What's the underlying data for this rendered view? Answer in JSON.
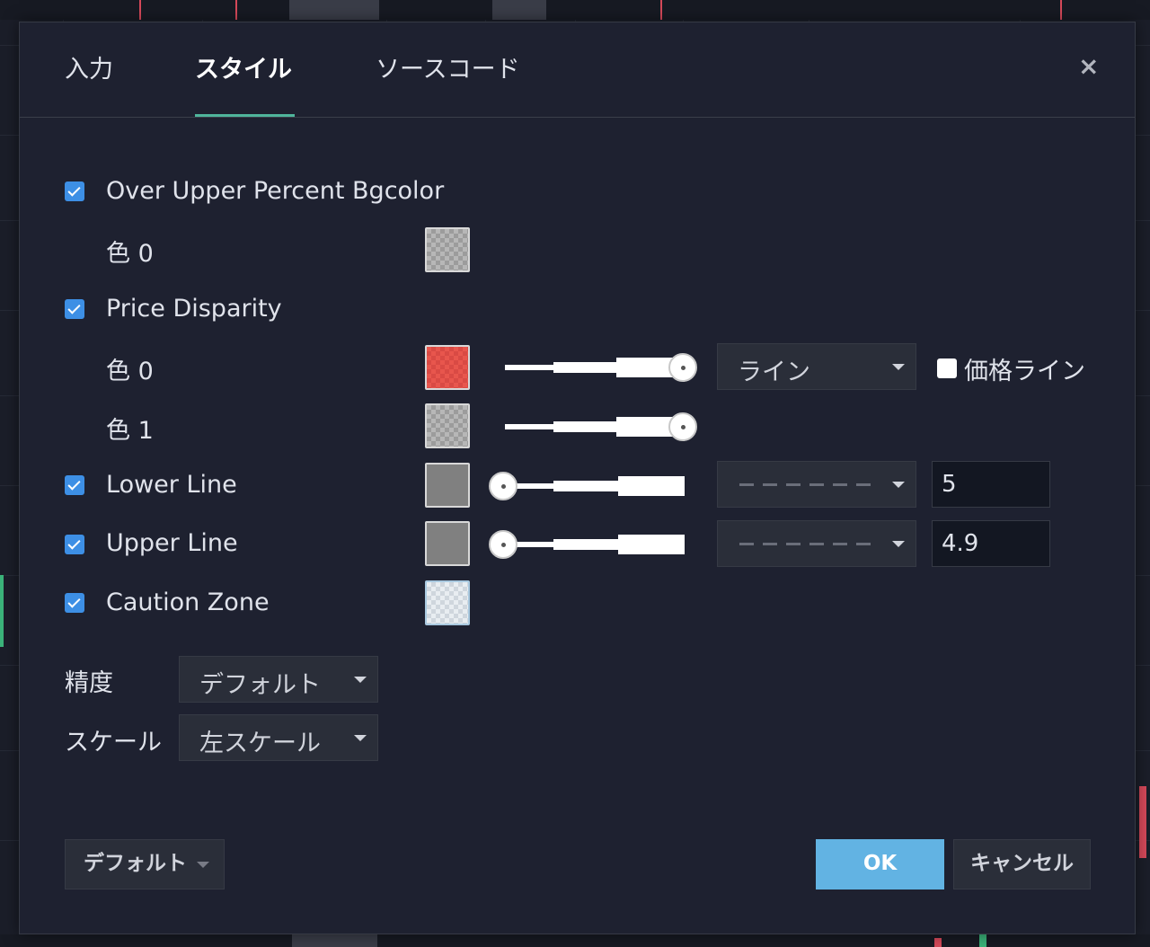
{
  "tabs": [
    {
      "label": "入力"
    },
    {
      "label": "スタイル"
    },
    {
      "label": "ソースコード"
    }
  ],
  "close_glyph": "×",
  "plots": {
    "over_upper": {
      "label": "Over Upper Percent Bgcolor",
      "checked": true,
      "color0_label": "色 0"
    },
    "price_disparity": {
      "label": "Price Disparity",
      "checked": true,
      "color0_label": "色 0",
      "color1_label": "色 1",
      "plot_type": "ライン",
      "price_line_label": "価格ライン",
      "price_line_checked": false
    },
    "lower_line": {
      "label": "Lower Line",
      "checked": true,
      "value": "5",
      "color": "#808080"
    },
    "upper_line": {
      "label": "Upper Line",
      "checked": true,
      "value": "4.9",
      "color": "#808080"
    },
    "caution_zone": {
      "label": "Caution Zone",
      "checked": true
    }
  },
  "precision": {
    "label": "精度",
    "value": "デフォルト"
  },
  "scale": {
    "label": "スケール",
    "value": "左スケール"
  },
  "footer": {
    "default_label": "デフォルト",
    "ok_label": "OK",
    "cancel_label": "キャンセル"
  },
  "colors": {
    "accent": "#4fb59b",
    "ok_button": "#62b3e3",
    "checkbox": "#3d8fe5",
    "price_disparity_color0": "#e8564d"
  }
}
